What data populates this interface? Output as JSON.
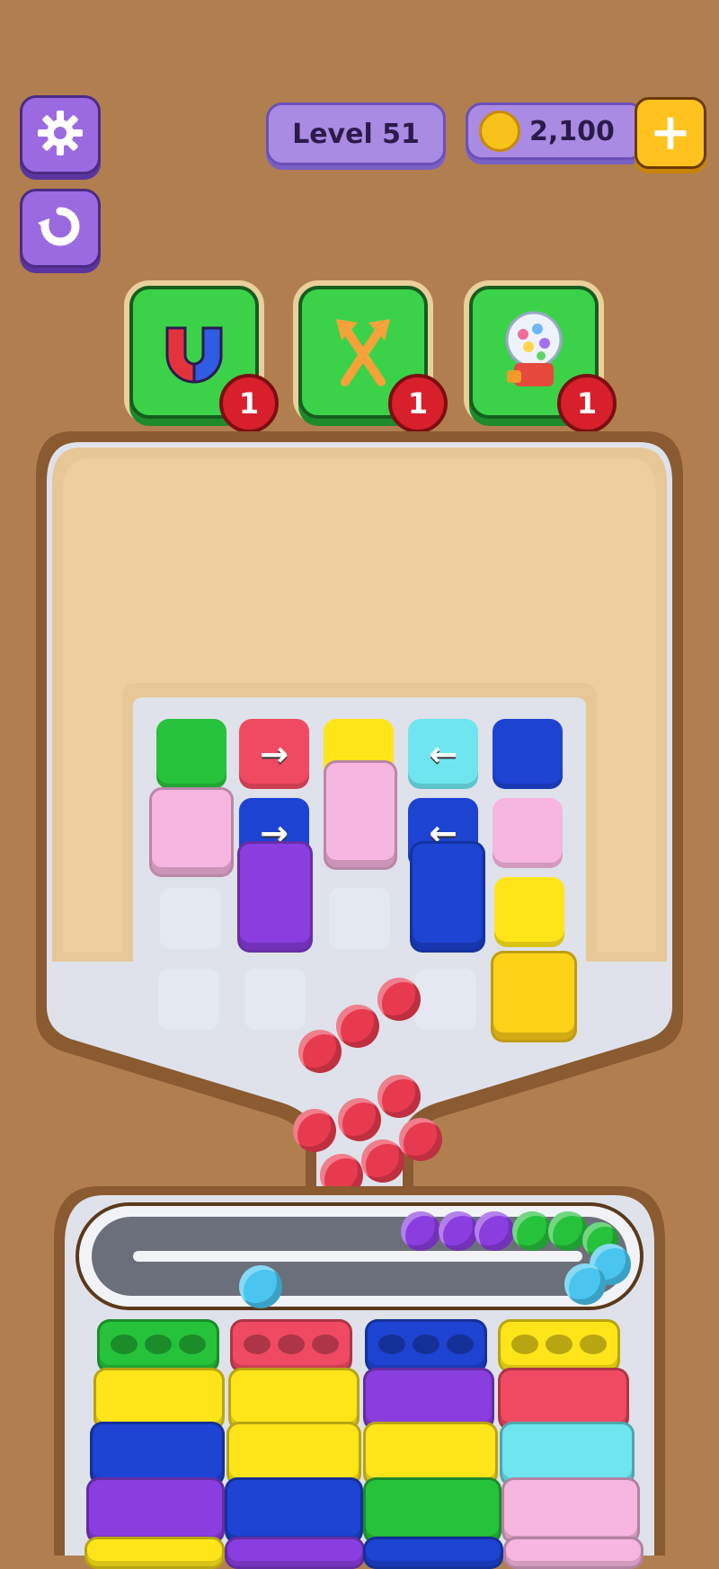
{
  "hud": {
    "level_label": "Level 51",
    "coins": "2,100",
    "buttons": {
      "settings": "settings",
      "restart": "restart",
      "add_coins": "+"
    }
  },
  "boosters": [
    {
      "name": "magnet",
      "icon": "magnet-icon",
      "count": "1"
    },
    {
      "name": "shuffle",
      "icon": "shuffle-icon",
      "count": "1"
    },
    {
      "name": "gumball",
      "icon": "gumball-machine-icon",
      "count": "1"
    }
  ],
  "colors": {
    "green": "#27c23c",
    "red": "#f04a62",
    "yellow": "#ffe51a",
    "cyan": "#6fe6ef",
    "blue": "#1d43d3",
    "pink": "#f7b6df",
    "purple": "#8a3ee0",
    "ball_red": "#e83a4f",
    "ball_cyan": "#49c5ef"
  },
  "board_arrows": [
    "→",
    "←",
    "→",
    "←"
  ]
}
